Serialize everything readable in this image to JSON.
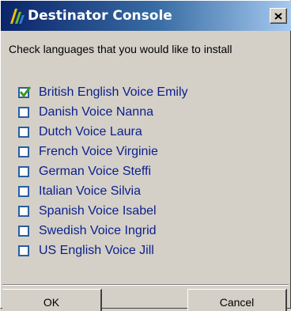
{
  "window": {
    "title": "Destinator Console",
    "icon": "destinator-app-icon",
    "close_icon": "close-x-icon"
  },
  "instruction": "Check languages that you would like to install",
  "languages": [
    {
      "label": "British English Voice Emily",
      "checked": true
    },
    {
      "label": "Danish Voice Nanna",
      "checked": false
    },
    {
      "label": "Dutch Voice Laura",
      "checked": false
    },
    {
      "label": "French Voice Virginie",
      "checked": false
    },
    {
      "label": "German Voice Steffi",
      "checked": false
    },
    {
      "label": "Italian Voice Silvia",
      "checked": false
    },
    {
      "label": "Spanish Voice Isabel",
      "checked": false
    },
    {
      "label": "Swedish Voice Ingrid",
      "checked": false
    },
    {
      "label": "US English Voice Jill",
      "checked": false
    }
  ],
  "buttons": {
    "ok": "OK",
    "cancel": "Cancel"
  },
  "colors": {
    "title_gradient_start": "#0a246a",
    "title_gradient_end": "#a6caf0",
    "item_text": "#0b1f8c",
    "checkbox_border": "#2b5da0",
    "checkmark": "#3c9a2a"
  }
}
